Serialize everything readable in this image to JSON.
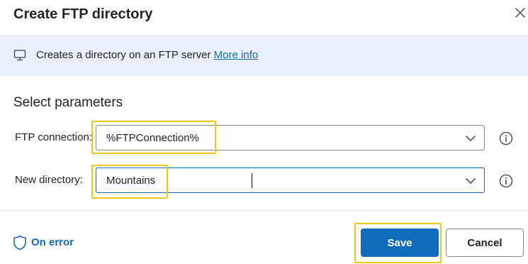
{
  "dialog": {
    "title": "Create FTP directory",
    "close_icon": "close-icon"
  },
  "banner": {
    "icon": "computer-icon",
    "text": "Creates a directory on an FTP server",
    "link": "More info"
  },
  "parameters": {
    "section_title": "Select parameters",
    "ftp_connection": {
      "label": "FTP connection:",
      "value": "%FTPConnection%"
    },
    "new_directory": {
      "label": "New directory:",
      "value": "Mountains"
    }
  },
  "footer": {
    "on_error_label": "On error",
    "save_label": "Save",
    "cancel_label": "Cancel"
  },
  "colors": {
    "accent": "#0f6cbd",
    "banner_bg": "#e9f0fb",
    "highlight": "#f5c518"
  }
}
